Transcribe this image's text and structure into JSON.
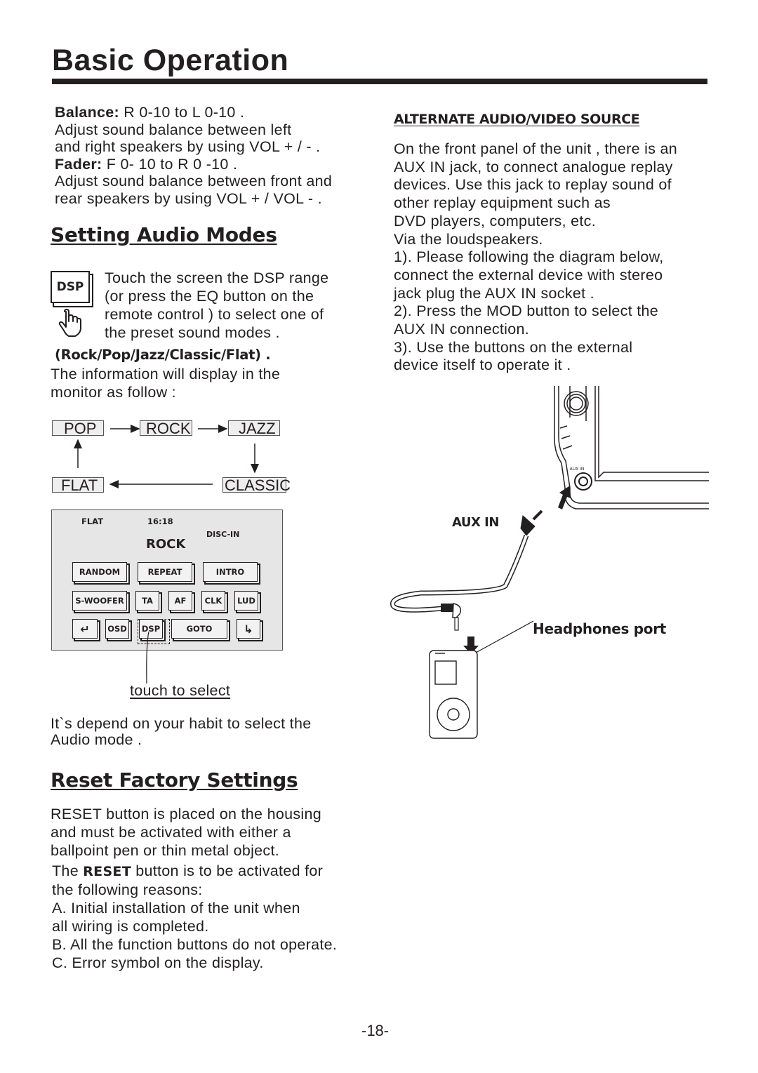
{
  "page": {
    "title": "Basic Operation",
    "page_number": "-18-"
  },
  "balance_fader": {
    "balance_label": "Balance:",
    "balance_range": " R 0-10 to L 0-10 .",
    "balance_desc": [
      "Adjust sound balance between left",
      "and right speakers by using VOL + / - ."
    ],
    "fader_label": "Fader:",
    "fader_range": " F 0- 10 to R 0 -10 .",
    "fader_desc": [
      "Adjust sound balance between front and",
      "rear speakers by using VOL + / VOL - ."
    ]
  },
  "audio_modes": {
    "heading": "Setting Audio Modes",
    "dsp_icon_label": "DSP",
    "instruction": [
      "Touch the screen the DSP range",
      "(or press the EQ button on the",
      "remote control ) to select one of",
      "the preset sound modes ."
    ],
    "modes_list": "(Rock/Pop/Jazz/Classic/Flat) .",
    "display_note": [
      "The information will display in the",
      "monitor as follow :"
    ],
    "flow": {
      "pop": "POP",
      "rock": "ROCK",
      "jazz": "JAZZ",
      "classic": "CLASSIC",
      "flat": "FLAT"
    },
    "screen": {
      "eq_mode": "FLAT",
      "clock": "16:18",
      "disc_status": "DISC-IN",
      "current_mode": "ROCK",
      "buttons_row1": [
        "RANDOM",
        "REPEAT",
        "INTRO"
      ],
      "buttons_row2": [
        "S-WOOFER",
        "TA",
        "AF",
        "CLK",
        "LUD"
      ],
      "buttons_row3": {
        "back": "↵",
        "osd": "OSD",
        "dsp": "DSP",
        "goto": "GOTO",
        "next": "↳"
      }
    },
    "touch_label": "touch to select",
    "habit_note": [
      "It`s depend on your habit to select the",
      "Audio mode ."
    ]
  },
  "reset": {
    "heading": "Reset Factory Settings",
    "intro": [
      "RESET button is placed on the housing",
      "and must be activated with either a",
      "ballpoint pen or thin metal object."
    ],
    "reasons_prefix": "The ",
    "reasons_bold": "RESET",
    "reasons_suffix": " button  is to be activated for",
    "reasons_line2": "the following reasons:",
    "reasons": [
      "A. Initial installation of the unit when",
      "all wiring is completed.",
      "B. All the function buttons do not operate.",
      "C. Error symbol on the display."
    ]
  },
  "alt_source": {
    "heading": "ALTERNATE AUDIO/VIDEO SOURCE",
    "paragraph": [
      "On the front panel of the unit , there is an",
      "AUX IN jack, to connect analogue replay",
      "devices. Use this jack to replay sound of",
      "other replay equipment such as",
      "DVD players, computers, etc.",
      "Via the loudspeakers."
    ],
    "steps": [
      "1). Please  following the diagram below,",
      "connect the external device with stereo",
      "jack plug the AUX IN socket .",
      "2). Press the MOD button to select the",
      "AUX IN connection.",
      "3). Use the buttons on the external",
      "device itself to operate it ."
    ],
    "diagram": {
      "panel_label": "AUX IN",
      "cable_label": "AUX IN",
      "port_label": "Headphones port"
    }
  }
}
